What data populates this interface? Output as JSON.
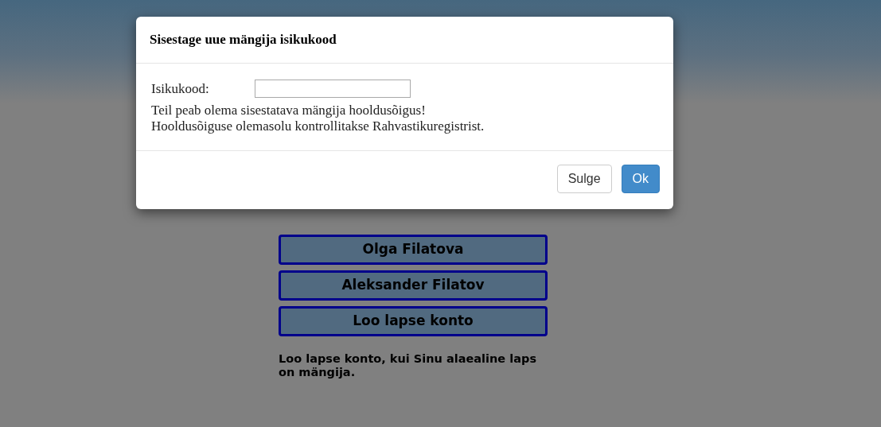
{
  "dialog": {
    "title": "Sisestage uue mängija isikukood",
    "field_label": "Isikukood:",
    "notes": [
      "Teil peab olema sisestatava mängija hooldusõigus!",
      "Hooldusõiguse olemasolu kontrollitakse Rahvastikuregistrist."
    ],
    "buttons": [
      {
        "label": "Sulge",
        "kind": "default"
      },
      {
        "label": "Ok",
        "kind": "primary"
      }
    ]
  },
  "accounts": [
    {
      "label": "Olga Filatova"
    },
    {
      "label": "Aleksander Filatov"
    },
    {
      "label": "Loo lapse konto"
    }
  ],
  "hint": "Loo lapse konto, kui Sinu alaealine laps on mängija."
}
